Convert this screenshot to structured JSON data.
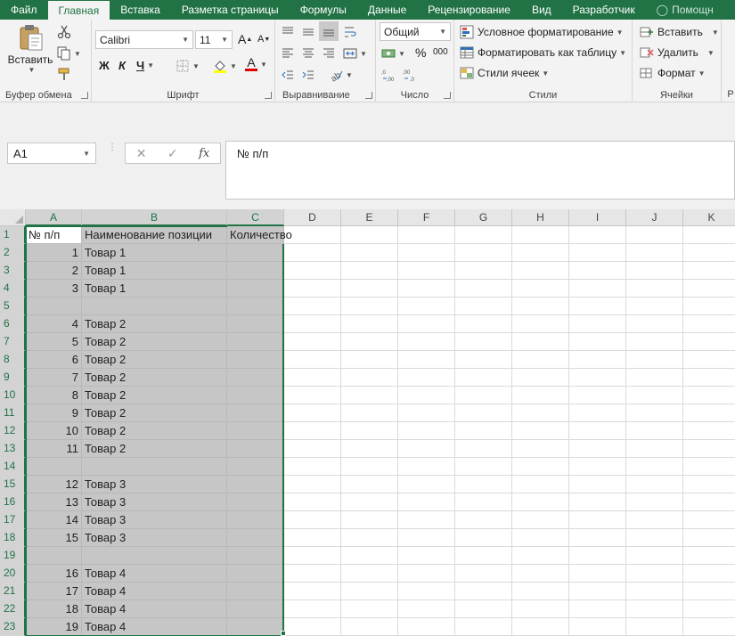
{
  "tabs": [
    {
      "label": "Файл",
      "active": false
    },
    {
      "label": "Главная",
      "active": true
    },
    {
      "label": "Вставка",
      "active": false
    },
    {
      "label": "Разметка страницы",
      "active": false
    },
    {
      "label": "Формулы",
      "active": false
    },
    {
      "label": "Данные",
      "active": false
    },
    {
      "label": "Рецензирование",
      "active": false
    },
    {
      "label": "Вид",
      "active": false
    },
    {
      "label": "Разработчик",
      "active": false
    }
  ],
  "tell_me": "Помощн",
  "ribbon": {
    "clipboard": {
      "label": "Буфер обмена",
      "paste": "Вставить"
    },
    "font": {
      "label": "Шрифт",
      "name": "Calibri",
      "size": "11",
      "bold": "Ж",
      "italic": "К",
      "underline": "Ч",
      "grow": "A",
      "shrink": "A",
      "color_letter": "A"
    },
    "alignment": {
      "label": "Выравнивание"
    },
    "number": {
      "label": "Число",
      "format": "Общий",
      "percent": "%",
      "thousands": "000"
    },
    "styles": {
      "label": "Стили",
      "conditional": "Условное форматирование",
      "as_table": "Форматировать как таблицу",
      "cell_styles": "Стили ячеек"
    },
    "cells": {
      "label": "Ячейки",
      "insert": "Вставить",
      "delete": "Удалить",
      "format": "Формат"
    },
    "next_group_initial": "Р"
  },
  "namebox": "A1",
  "formula": "№ п/п",
  "fx": "fx",
  "columns": [
    "A",
    "B",
    "C",
    "D",
    "E",
    "F",
    "G",
    "H",
    "I",
    "J",
    "K"
  ],
  "selected_columns": [
    "A",
    "B",
    "C"
  ],
  "rows": [
    {
      "n": "1",
      "a": "№ п/п",
      "b": "Наименование позиции",
      "c": "Количество"
    },
    {
      "n": "2",
      "a": "1",
      "b": "Товар 1",
      "c": ""
    },
    {
      "n": "3",
      "a": "2",
      "b": "Товар 1",
      "c": ""
    },
    {
      "n": "4",
      "a": "3",
      "b": "Товар 1",
      "c": ""
    },
    {
      "n": "5",
      "a": "",
      "b": "",
      "c": ""
    },
    {
      "n": "6",
      "a": "4",
      "b": "Товар 2",
      "c": ""
    },
    {
      "n": "7",
      "a": "5",
      "b": "Товар 2",
      "c": ""
    },
    {
      "n": "8",
      "a": "6",
      "b": "Товар 2",
      "c": ""
    },
    {
      "n": "9",
      "a": "7",
      "b": "Товар 2",
      "c": ""
    },
    {
      "n": "10",
      "a": "8",
      "b": "Товар 2",
      "c": ""
    },
    {
      "n": "11",
      "a": "9",
      "b": "Товар 2",
      "c": ""
    },
    {
      "n": "12",
      "a": "10",
      "b": "Товар 2",
      "c": ""
    },
    {
      "n": "13",
      "a": "11",
      "b": "Товар 2",
      "c": ""
    },
    {
      "n": "14",
      "a": "",
      "b": "",
      "c": ""
    },
    {
      "n": "15",
      "a": "12",
      "b": "Товар 3",
      "c": ""
    },
    {
      "n": "16",
      "a": "13",
      "b": "Товар 3",
      "c": ""
    },
    {
      "n": "17",
      "a": "14",
      "b": "Товар 3",
      "c": ""
    },
    {
      "n": "18",
      "a": "15",
      "b": "Товар 3",
      "c": ""
    },
    {
      "n": "19",
      "a": "",
      "b": "",
      "c": ""
    },
    {
      "n": "20",
      "a": "16",
      "b": "Товар 4",
      "c": ""
    },
    {
      "n": "21",
      "a": "17",
      "b": "Товар 4",
      "c": ""
    },
    {
      "n": "22",
      "a": "18",
      "b": "Товар 4",
      "c": ""
    },
    {
      "n": "23",
      "a": "19",
      "b": "Товар 4",
      "c": ""
    }
  ],
  "colors": {
    "accent": "#217346",
    "selection": "#c6c6c6",
    "ribbon_bg": "#f3f3f3"
  }
}
